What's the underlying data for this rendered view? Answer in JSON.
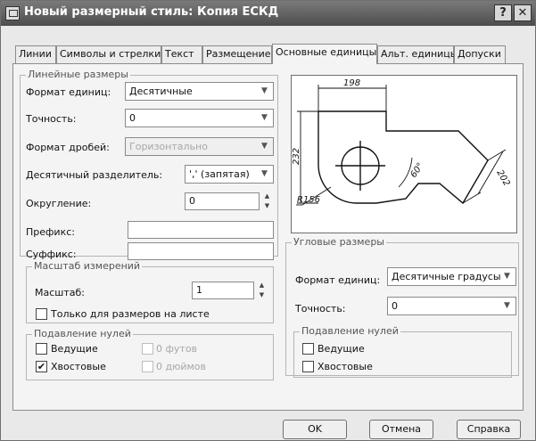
{
  "window": {
    "title": "Новый размерный стиль: Копия ЕСКД",
    "help_label": "?",
    "close_label": "✕"
  },
  "tabs": [
    {
      "label": "Линии"
    },
    {
      "label": "Символы и стрелки"
    },
    {
      "label": "Текст"
    },
    {
      "label": "Размещение"
    },
    {
      "label": "Основные единицы"
    },
    {
      "label": "Альт. единицы"
    },
    {
      "label": "Допуски"
    }
  ],
  "active_tab": "Основные единицы",
  "linear": {
    "legend": "Линейные размеры",
    "unit_format_label": "Формат единиц:",
    "unit_format_value": "Десятичные",
    "precision_label": "Точность:",
    "precision_value": "0",
    "fraction_label": "Формат дробей:",
    "fraction_value": "Горизонтально",
    "separator_label": "Десятичный разделитель:",
    "separator_value": "',' (запятая)",
    "rounding_label": "Округление:",
    "rounding_value": "0",
    "prefix_label": "Префикс:",
    "prefix_value": "",
    "suffix_label": "Суффикс:",
    "suffix_value": ""
  },
  "scale": {
    "legend": "Масштаб измерений",
    "scale_label": "Масштаб:",
    "scale_value": "1",
    "layout_only_label": "Только для размеров на листе",
    "layout_only_checked": false
  },
  "zero_linear": {
    "legend": "Подавление нулей",
    "leading_label": "Ведущие",
    "leading_checked": false,
    "trailing_label": "Хвостовые",
    "trailing_checked": true,
    "feet_label": "0 футов",
    "inches_label": "0 дюймов"
  },
  "preview": {
    "dim_top": "198",
    "dim_left": "232",
    "dim_right": "202",
    "dim_angle": "60°",
    "dim_radius": "R156"
  },
  "angular": {
    "legend": "Угловые размеры",
    "unit_format_label": "Формат единиц:",
    "unit_format_value": "Десятичные градусы",
    "precision_label": "Точность:",
    "precision_value": "0"
  },
  "zero_angular": {
    "legend": "Подавление нулей",
    "leading_label": "Ведущие",
    "leading_checked": false,
    "trailing_label": "Хвостовые",
    "trailing_checked": false
  },
  "buttons": {
    "ok": "OK",
    "cancel": "Отмена",
    "help": "Справка"
  },
  "icons": {
    "dropdown": "chevron-down-icon",
    "spin_up": "spin-up-icon",
    "spin_down": "spin-down-icon",
    "check": "✔",
    "window_icon": "dimstyle-icon"
  }
}
